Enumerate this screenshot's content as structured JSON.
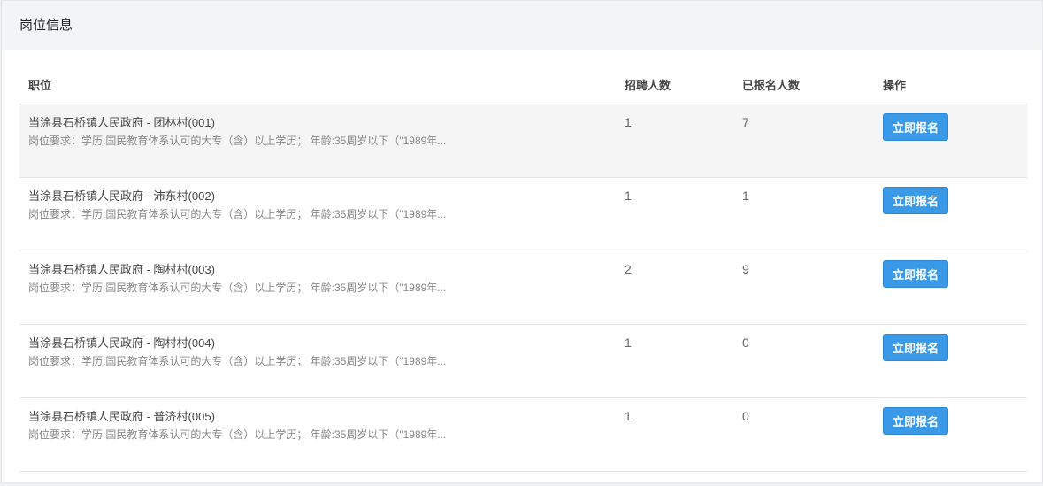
{
  "header": {
    "title": "岗位信息"
  },
  "table": {
    "columns": [
      "职位",
      "招聘人数",
      "已报名人数",
      "操作"
    ],
    "rows": [
      {
        "title": "当涂县石桥镇人民政府 - 团林村(001)",
        "req": "岗位要求：学历:国民教育体系认可的大专（含）以上学历； 年龄:35周岁以下（\"1989年...",
        "hire": "1",
        "applied": "7",
        "action": "立即报名"
      },
      {
        "title": "当涂县石桥镇人民政府 - 沛东村(002)",
        "req": "岗位要求：学历:国民教育体系认可的大专（含）以上学历； 年龄:35周岁以下（\"1989年...",
        "hire": "1",
        "applied": "1",
        "action": "立即报名"
      },
      {
        "title": "当涂县石桥镇人民政府 - 陶村村(003)",
        "req": "岗位要求：学历:国民教育体系认可的大专（含）以上学历； 年龄:35周岁以下（\"1989年...",
        "hire": "2",
        "applied": "9",
        "action": "立即报名"
      },
      {
        "title": "当涂县石桥镇人民政府 - 陶村村(004)",
        "req": "岗位要求：学历:国民教育体系认可的大专（含）以上学历； 年龄:35周岁以下（\"1989年...",
        "hire": "1",
        "applied": "0",
        "action": "立即报名"
      },
      {
        "title": "当涂县石桥镇人民政府 - 普济村(005)",
        "req": "岗位要求：学历:国民教育体系认可的大专（含）以上学历； 年龄:35周岁以下（\"1989年...",
        "hire": "1",
        "applied": "0",
        "action": "立即报名"
      }
    ]
  }
}
